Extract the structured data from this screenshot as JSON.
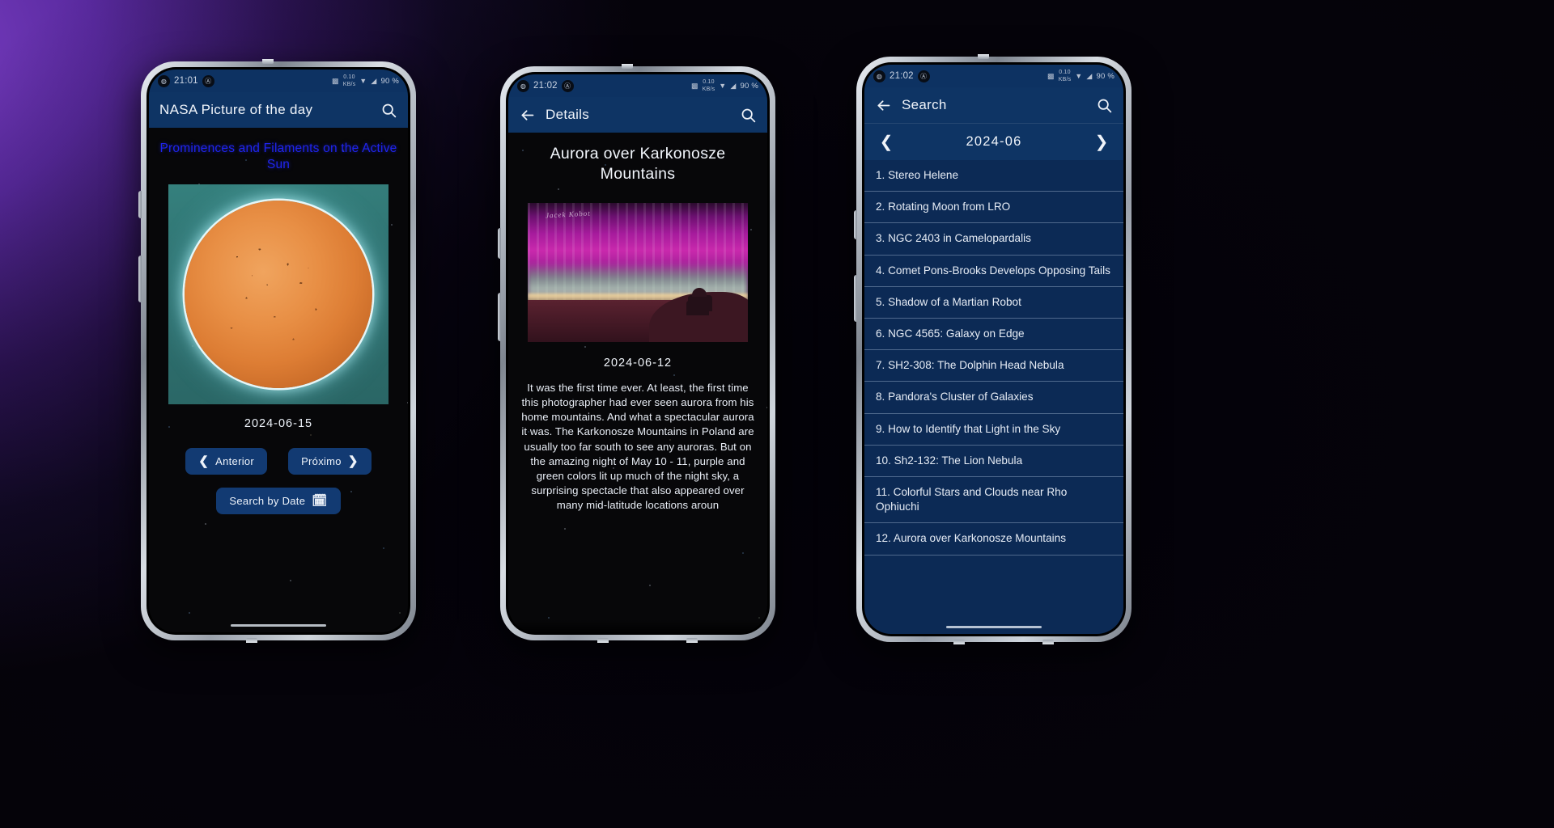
{
  "phone1": {
    "status": {
      "time": "21:01",
      "battery": "90 %",
      "net": "0.10\nKB/s",
      "left_icon": "media-icon",
      "second_icon": "app-icon",
      "icons": [
        "sim-icon",
        "network-speed-icon",
        "wifi-icon",
        "signal-icon"
      ]
    },
    "appbar": {
      "title": "NASA Picture of the day",
      "search_icon": "search-icon"
    },
    "picture_title": "Prominences and Filaments on the Active Sun",
    "image_alt": "active-sun-image",
    "date": "2024-06-15",
    "prev_label": "Anterior",
    "next_label": "Próximo",
    "search_by_date_label": "Search by Date",
    "calendar_icon": "calendar-icon"
  },
  "phone2": {
    "status": {
      "time": "21:02",
      "battery": "90 %",
      "net": "0.10\nKB/s"
    },
    "appbar": {
      "title": "Details",
      "back_icon": "back-arrow-icon",
      "search_icon": "search-icon"
    },
    "detail_title": "Aurora over Karkonosze Mountains",
    "image_alt": "aurora-over-karkonosze-image",
    "signature": "Jacek Kobot",
    "date": "2024-06-12",
    "explanation": "It was the first time ever. At least, the first time this photographer had ever seen aurora from his home mountains.  And what a spectacular aurora it was. The Karkonosze Mountains in Poland are usually too far south to see any auroras.  But on the amazing night of May 10 - 11, purple and green colors lit up much of the night sky, a surprising spectacle that  also appeared over many mid-latitude locations aroun"
  },
  "phone3": {
    "status": {
      "time": "21:02",
      "battery": "90 %",
      "net": "0.10\nKB/s"
    },
    "appbar": {
      "title": "Search",
      "back_icon": "back-arrow-icon",
      "search_icon": "search-icon"
    },
    "datebar": {
      "value": "2024-06",
      "prev_icon": "chevron-left-icon",
      "next_icon": "chevron-right-icon"
    },
    "results": [
      "1. Stereo Helene",
      "2. Rotating Moon from LRO",
      "3. NGC 2403 in Camelopardalis",
      "4. Comet Pons-Brooks Develops Opposing Tails",
      "5. Shadow of a Martian Robot",
      "6. NGC 4565: Galaxy on Edge",
      "7. SH2-308: The Dolphin Head Nebula",
      "8. Pandora's Cluster of Galaxies",
      "9. How to Identify that Light in the Sky",
      "10. Sh2-132: The Lion Nebula",
      "11. Colorful Stars and Clouds near Rho Ophiuchi",
      "12. Aurora over Karkonosze Mountains"
    ]
  },
  "colors": {
    "appbar_blue": "#0e3464",
    "panel_blue": "#0c2a55",
    "button_blue": "#123a72",
    "title_blue": "#1f24ee",
    "text_light": "#f0f4fa"
  }
}
